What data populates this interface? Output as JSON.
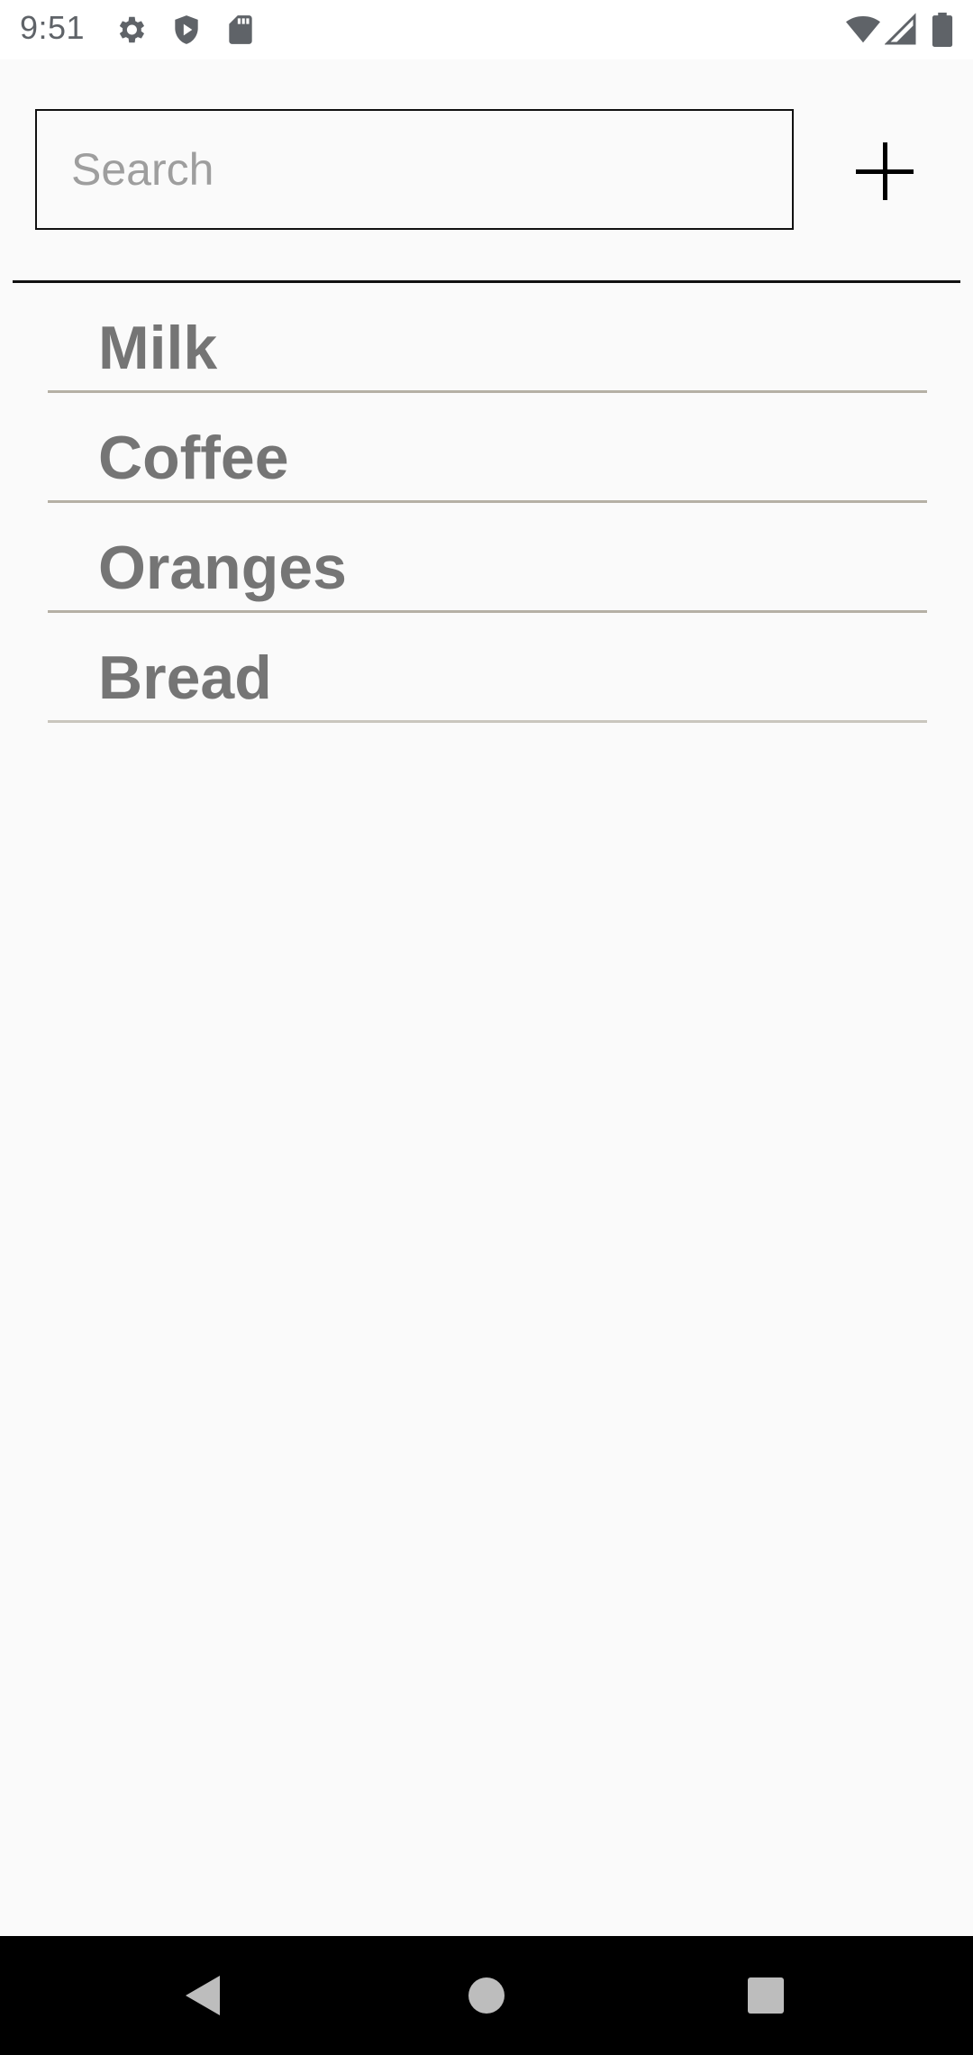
{
  "status_bar": {
    "time": "9:51",
    "left_icons": [
      "gear-icon",
      "shield-play-icon",
      "sd-card-icon"
    ],
    "right_icons": [
      "wifi-icon",
      "cell-signal-icon",
      "battery-icon"
    ]
  },
  "search": {
    "placeholder": "Search",
    "value": ""
  },
  "add_button": {
    "icon": "plus-icon"
  },
  "items": [
    {
      "label": "Milk"
    },
    {
      "label": "Coffee"
    },
    {
      "label": "Oranges"
    },
    {
      "label": "Bread"
    }
  ],
  "nav_bar": {
    "buttons": [
      "back-triangle-icon",
      "home-circle-icon",
      "recents-square-icon"
    ]
  },
  "colors": {
    "background": "#fafafa",
    "item_text": "#757575",
    "divider": "#b5b0a5",
    "nav_bar": "#000000"
  }
}
